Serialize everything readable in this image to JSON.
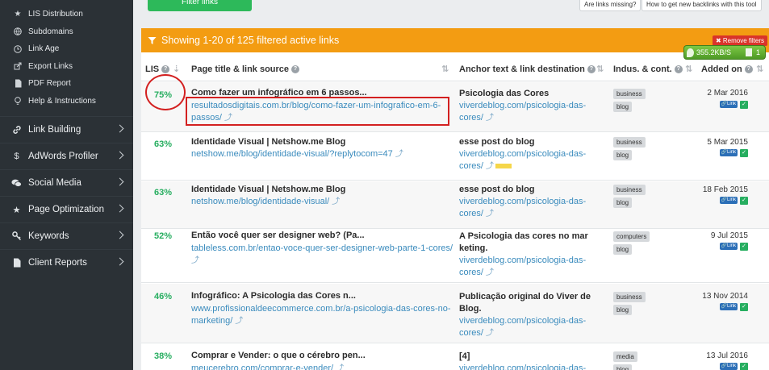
{
  "sidebar": {
    "sub_items": [
      {
        "label": "LIS Distribution",
        "icon": "star-icon"
      },
      {
        "label": "Subdomains",
        "icon": "globe-icon"
      },
      {
        "label": "Link Age",
        "icon": "clock-icon"
      },
      {
        "label": "Export Links",
        "icon": "export-icon"
      },
      {
        "label": "PDF Report",
        "icon": "document-icon"
      },
      {
        "label": "Help & Instructions",
        "icon": "bulb-icon"
      }
    ],
    "main_items": [
      {
        "label": "Link Building",
        "icon": "link-icon"
      },
      {
        "label": "AdWords Profiler",
        "icon": "dollar-icon"
      },
      {
        "label": "Social Media",
        "icon": "comments-icon"
      },
      {
        "label": "Page Optimization",
        "icon": "star-icon"
      },
      {
        "label": "Keywords",
        "icon": "key-icon"
      },
      {
        "label": "Client Reports",
        "icon": "document-icon"
      }
    ]
  },
  "toolbar": {
    "filter_label": "Filter links",
    "missing_label": "Are links missing?",
    "howto_label": "How to get new backlinks with this tool"
  },
  "panel": {
    "heading": "Showing 1-20 of 125 filtered active links",
    "remove_filters": "Remove filters"
  },
  "speed_widget": {
    "speed": "355.2KB/S",
    "count": "1"
  },
  "table": {
    "columns": {
      "lis": "LIS",
      "page": "Page title & link source",
      "anchor": "Anchor text & link destination",
      "industry": "Indus. & cont.",
      "added": "Added on"
    },
    "rows": [
      {
        "lis": "75%",
        "title": "Como fazer um infográfico em 6 passos...",
        "src": "resultadosdigitais.com.br/blog/como-fazer-um-infografico-em-6-passos/",
        "anchor": "Psicologia das Cores",
        "dest": "viverdeblog.com/psicologia-das-cores/",
        "tags": [
          "business",
          "blog"
        ],
        "date": "2 Mar 2016"
      },
      {
        "lis": "63%",
        "title": "Identidade Visual | Netshow.me Blog",
        "src": "netshow.me/blog/identidade-visual/?replytocom=47",
        "anchor": "esse post do blog",
        "dest": "viverdeblog.com/psicologia-das-cores/",
        "tags": [
          "business",
          "blog"
        ],
        "date": "5 Mar 2015"
      },
      {
        "lis": "63%",
        "title": "Identidade Visual | Netshow.me Blog",
        "src": "netshow.me/blog/identidade-visual/",
        "anchor": "esse post do blog",
        "dest": "viverdeblog.com/psicologia-das-cores/",
        "tags": [
          "business",
          "blog"
        ],
        "date": "18 Feb 2015"
      },
      {
        "lis": "52%",
        "title": "Então você quer ser designer web? (Pa...",
        "src": "tableless.com.br/entao-voce-quer-ser-designer-web-parte-1-cores/",
        "anchor": "A Psicologia das cores no mar keting.",
        "dest": "viverdeblog.com/psicologia-das-cores/",
        "tags": [
          "computers",
          "blog"
        ],
        "date": "9 Jul 2015"
      },
      {
        "lis": "46%",
        "title": "Infográfico: A Psicologia das Cores n...",
        "src": "www.profissionaldeecommerce.com.br/a-psicologia-das-cores-no-marketing/",
        "anchor": "Publicação original do Viver de Blog.",
        "dest": "viverdeblog.com/psicologia-das-cores/",
        "tags": [
          "business",
          "blog"
        ],
        "date": "13 Nov 2014"
      },
      {
        "lis": "38%",
        "title": "Comprar e Vender: o que o cérebro pen...",
        "src": "meucerebro.com/comprar-e-vender/",
        "anchor": "[4]",
        "dest": "viverdeblog.com/psicologia-das-",
        "tags": [
          "media",
          "blog"
        ],
        "date": "13 Jul 2016"
      }
    ],
    "link_badge": "Link",
    "ext_arrow": "⤴"
  }
}
